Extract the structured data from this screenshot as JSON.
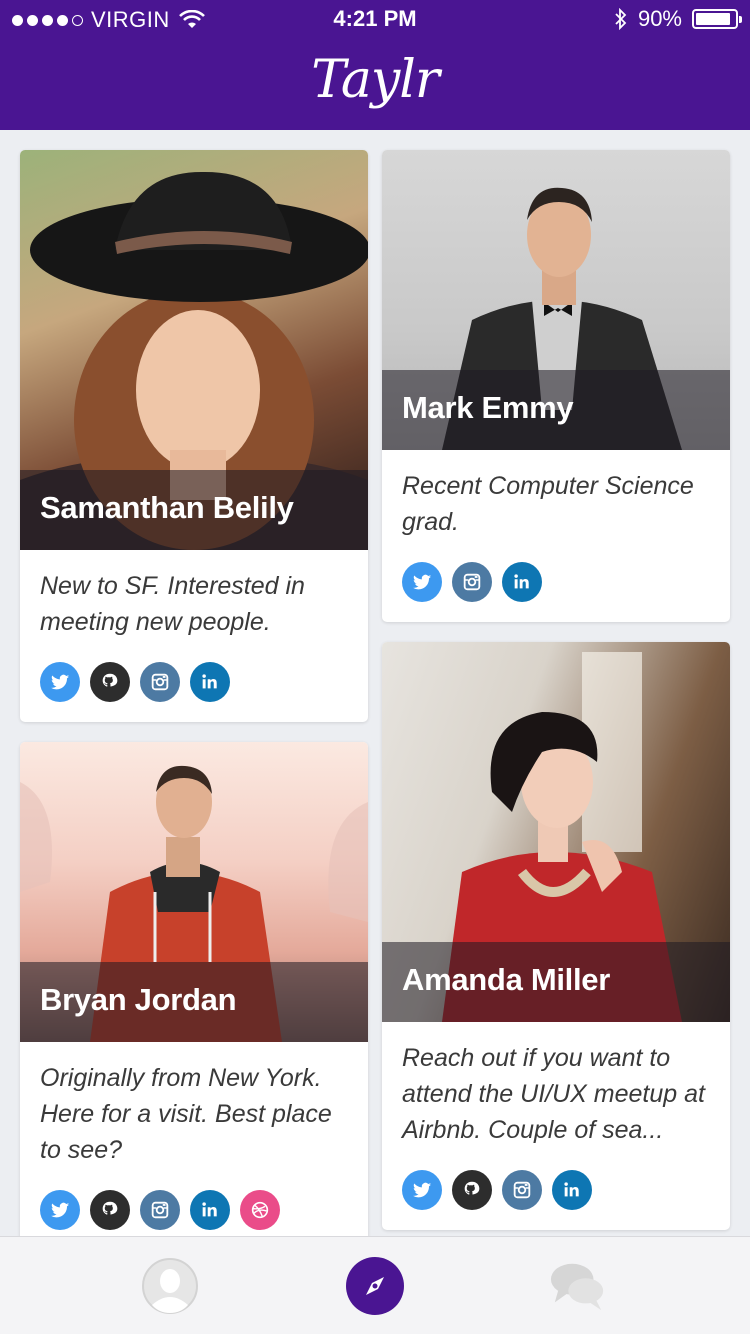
{
  "status_bar": {
    "carrier": "VIRGIN",
    "time": "4:21 PM",
    "battery": "90%",
    "battery_level": 0.9,
    "signal_bars_filled": 4,
    "signal_bars_total": 5
  },
  "app": {
    "title": "Taylr",
    "accent_color": "#4a1592"
  },
  "profiles": [
    {
      "name": "Samanthan Belily",
      "bio": "New to SF. Interested in meeting new people.",
      "socials": [
        "twitter-icon",
        "github-icon",
        "instagram-icon",
        "linkedin-icon"
      ]
    },
    {
      "name": "Mark Emmy",
      "bio": "Recent Computer Science grad.",
      "socials": [
        "twitter-icon",
        "instagram-icon",
        "linkedin-icon"
      ]
    },
    {
      "name": "Bryan Jordan",
      "bio": "Originally from New York. Here for a visit. Best place to see?",
      "socials": [
        "twitter-icon",
        "github-icon",
        "instagram-icon",
        "linkedin-icon",
        "dribbble-icon"
      ]
    },
    {
      "name": "Amanda Miller",
      "bio": "Reach out if you want to attend the UI/UX meetup at Airbnb. Couple of sea...",
      "socials": [
        "twitter-icon",
        "github-icon",
        "instagram-icon",
        "linkedin-icon"
      ]
    }
  ],
  "social_icons": {
    "twitter": "twitter-icon",
    "github": "github-icon",
    "instagram": "instagram-icon",
    "linkedin": "linkedin-icon",
    "dribbble": "dribbble-icon"
  },
  "tabs": [
    {
      "icon": "profile-icon",
      "active": false
    },
    {
      "icon": "compass-icon",
      "active": true
    },
    {
      "icon": "chat-bubbles-icon",
      "active": false
    }
  ]
}
